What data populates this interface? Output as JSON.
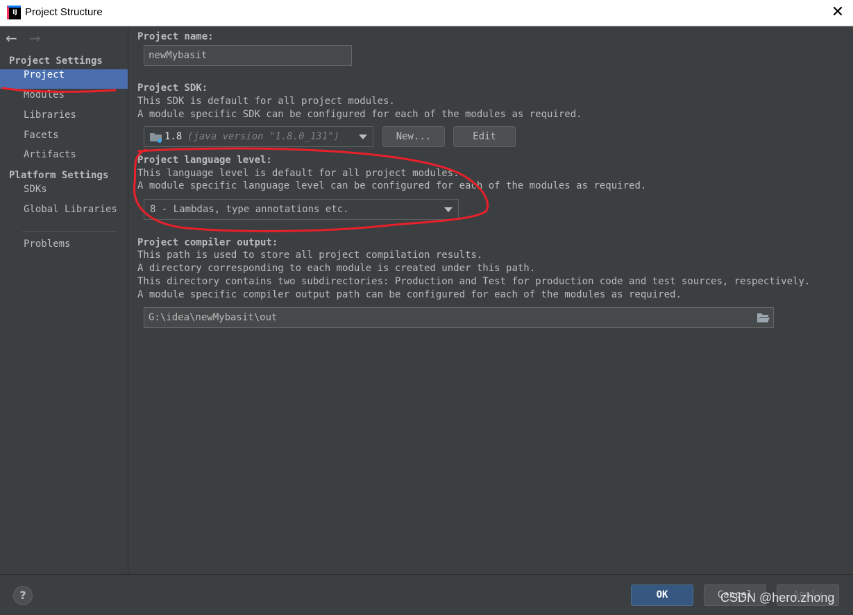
{
  "window": {
    "title": "Project Structure",
    "app_icon": "IJ"
  },
  "sidebar": {
    "back": "←",
    "forward": "→",
    "project_settings_title": "Project Settings",
    "project_settings_items": [
      "Project",
      "Modules",
      "Libraries",
      "Facets",
      "Artifacts"
    ],
    "selected_item": "Project",
    "platform_settings_title": "Platform Settings",
    "platform_settings_items": [
      "SDKs",
      "Global Libraries"
    ],
    "problems": "Problems"
  },
  "project_name": {
    "label": "Project name:",
    "value": "newMybasit"
  },
  "project_sdk": {
    "label": "Project SDK:",
    "desc1": "This SDK is default for all project modules.",
    "desc2": "A module specific SDK can be configured for each of the modules as required.",
    "sdk_version": "1.8",
    "sdk_detail": "(java version \"1.8.0_131\")",
    "new_button": "New...",
    "edit_button": "Edit"
  },
  "language_level": {
    "label": "Project language level:",
    "desc1": "This language level is default for all project modules.",
    "desc2": "A module specific language level can be configured for each of the modules as required.",
    "value": "8 - Lambdas, type annotations etc."
  },
  "compiler_output": {
    "label": "Project compiler output:",
    "desc1": "This path is used to store all project compilation results.",
    "desc2": "A directory corresponding to each module is created under this path.",
    "desc3": "This directory contains two subdirectories: Production and Test for production code and test sources, respectively.",
    "desc4": "A module specific compiler output path can be configured for each of the modules as required.",
    "path": "G:\\idea\\newMybasit\\out"
  },
  "footer": {
    "help": "?",
    "ok": "OK",
    "cancel": "Cancel",
    "apply": "Apply"
  },
  "watermark": "CSDN @hero.zhong",
  "colors": {
    "background": "#3c3f41",
    "selection": "#4b6eaf",
    "ok_button": "#365880",
    "annotation": "#e8202a"
  }
}
